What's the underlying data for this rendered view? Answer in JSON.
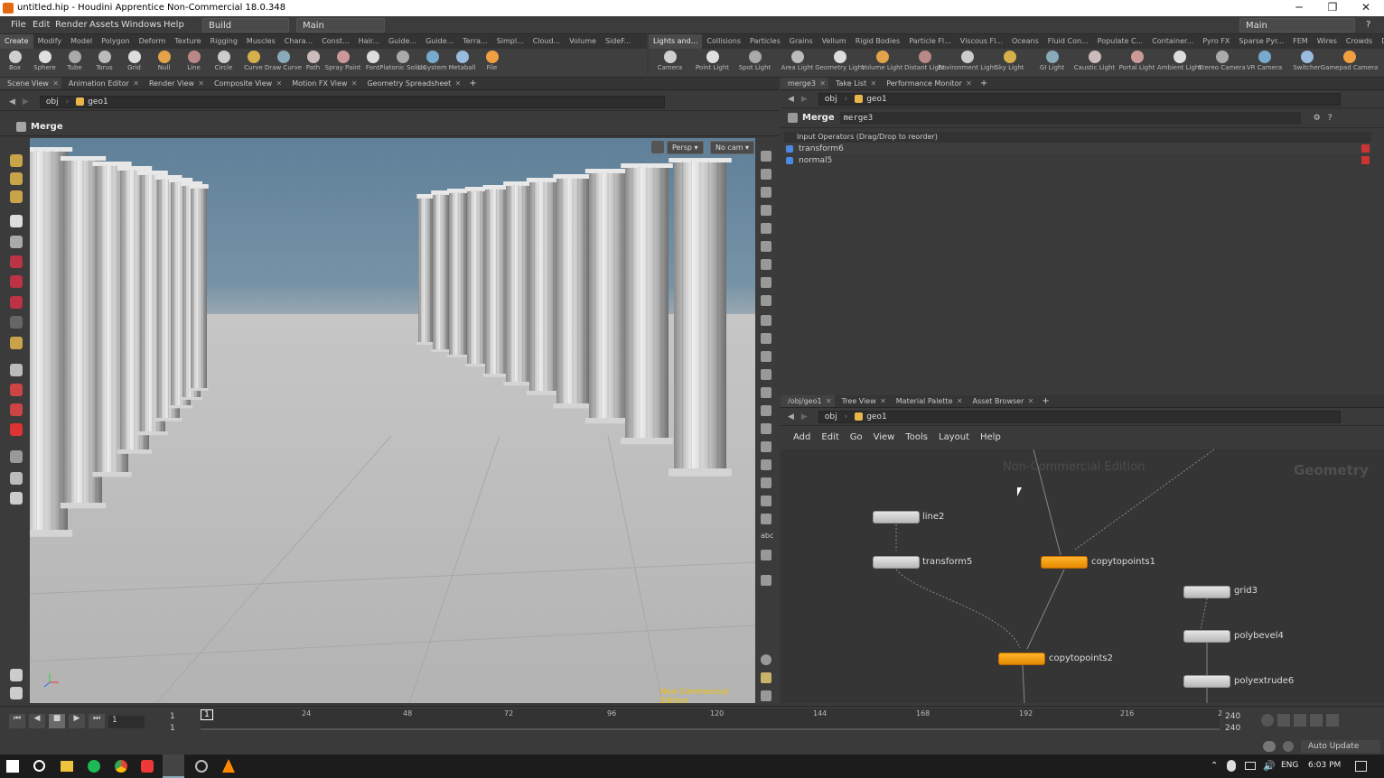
{
  "window": {
    "title": "untitled.hip - Houdini Apprentice Non-Commercial 18.0.348",
    "min": "─",
    "max": "❐",
    "close": "✕"
  },
  "menubar": {
    "items": [
      "File",
      "Edit",
      "Render",
      "Assets",
      "Windows",
      "Help"
    ],
    "build_desktop": "Build",
    "main_desktop": "Main",
    "right_desktop": "Main"
  },
  "shelf_left": {
    "tabs": [
      "Create",
      "Modify",
      "Model",
      "Polygon",
      "Deform",
      "Texture",
      "Rigging",
      "Muscles",
      "Chara...",
      "Const...",
      "Hair...",
      "Guide...",
      "Guide...",
      "Terra...",
      "Simpl...",
      "Cloud...",
      "Volume",
      "SideF..."
    ],
    "tools": [
      "Box",
      "Sphere",
      "Tube",
      "Torus",
      "Grid",
      "Null",
      "Line",
      "Circle",
      "Curve",
      "Draw Curve",
      "Path",
      "Spray Paint",
      "Font",
      "Platonic Solids",
      "L-System",
      "Metaball",
      "File"
    ]
  },
  "shelf_right": {
    "tabs": [
      "Lights and...",
      "Collisions",
      "Particles",
      "Grains",
      "Vellum",
      "Rigid Bodies",
      "Particle Fl...",
      "Viscous Fl...",
      "Oceans",
      "Fluid Con...",
      "Populate C...",
      "Container...",
      "Pyro FX",
      "Sparse Pyr...",
      "FEM",
      "Wires",
      "Crowds",
      "Drive Sim..."
    ],
    "tools": [
      "Camera",
      "Point Light",
      "Spot Light",
      "Area Light",
      "Geometry Light",
      "Volume Light",
      "Distant Light",
      "Environment Light",
      "Sky Light",
      "GI Light",
      "Caustic Light",
      "Portal Light",
      "Ambient Light",
      "Stereo Camera",
      "VR Camera",
      "Switcher",
      "Gamepad Camera"
    ]
  },
  "left_pane": {
    "tabs": [
      "Scene View",
      "Animation Editor",
      "Render View",
      "Composite View",
      "Motion FX View",
      "Geometry Spreadsheet"
    ],
    "path": [
      "obj",
      "geo1"
    ],
    "node_title": "Merge",
    "persp": "Persp ▾",
    "cam": "No cam ▾",
    "watermark": "Non-Commercial Edition"
  },
  "param_pane": {
    "tabs": [
      "merge3",
      "Take List",
      "Performance Monitor"
    ],
    "path": [
      "obj",
      "geo1"
    ],
    "node_type": "Merge",
    "node_name": "merge3",
    "section": "Input Operators (Drag/Drop to reorder)",
    "inputs": [
      "transform6",
      "normal5"
    ]
  },
  "net_pane": {
    "tabs": [
      "/obj/geo1",
      "Tree View",
      "Material Palette",
      "Asset Browser"
    ],
    "path": [
      "obj",
      "geo1"
    ],
    "menu": [
      "Add",
      "Edit",
      "Go",
      "View",
      "Tools",
      "Layout",
      "Help"
    ],
    "watermark": "Non-Commercial Edition",
    "context": "Geometry",
    "nodes": {
      "line2": "line2",
      "transform5": "transform5",
      "copytopoints1": "copytopoints1",
      "copytopoints2": "copytopoints2",
      "grid3": "grid3",
      "polybevel4": "polybevel4",
      "polyextrude6": "polyextrude6"
    }
  },
  "timeline": {
    "frame": "1",
    "start": "1",
    "start2": "1",
    "ticks": [
      "24",
      "48",
      "72",
      "96",
      "120",
      "144",
      "168",
      "192",
      "216",
      "2"
    ],
    "end": "240",
    "end2": "240",
    "current": "1"
  },
  "status": {
    "auto_update": "Auto Update"
  },
  "taskbar": {
    "lang": "ENG",
    "time": "6:03 PM"
  },
  "colors": {
    "node_orange": "#f5a00f",
    "houdini_orange": "#e36a12"
  }
}
